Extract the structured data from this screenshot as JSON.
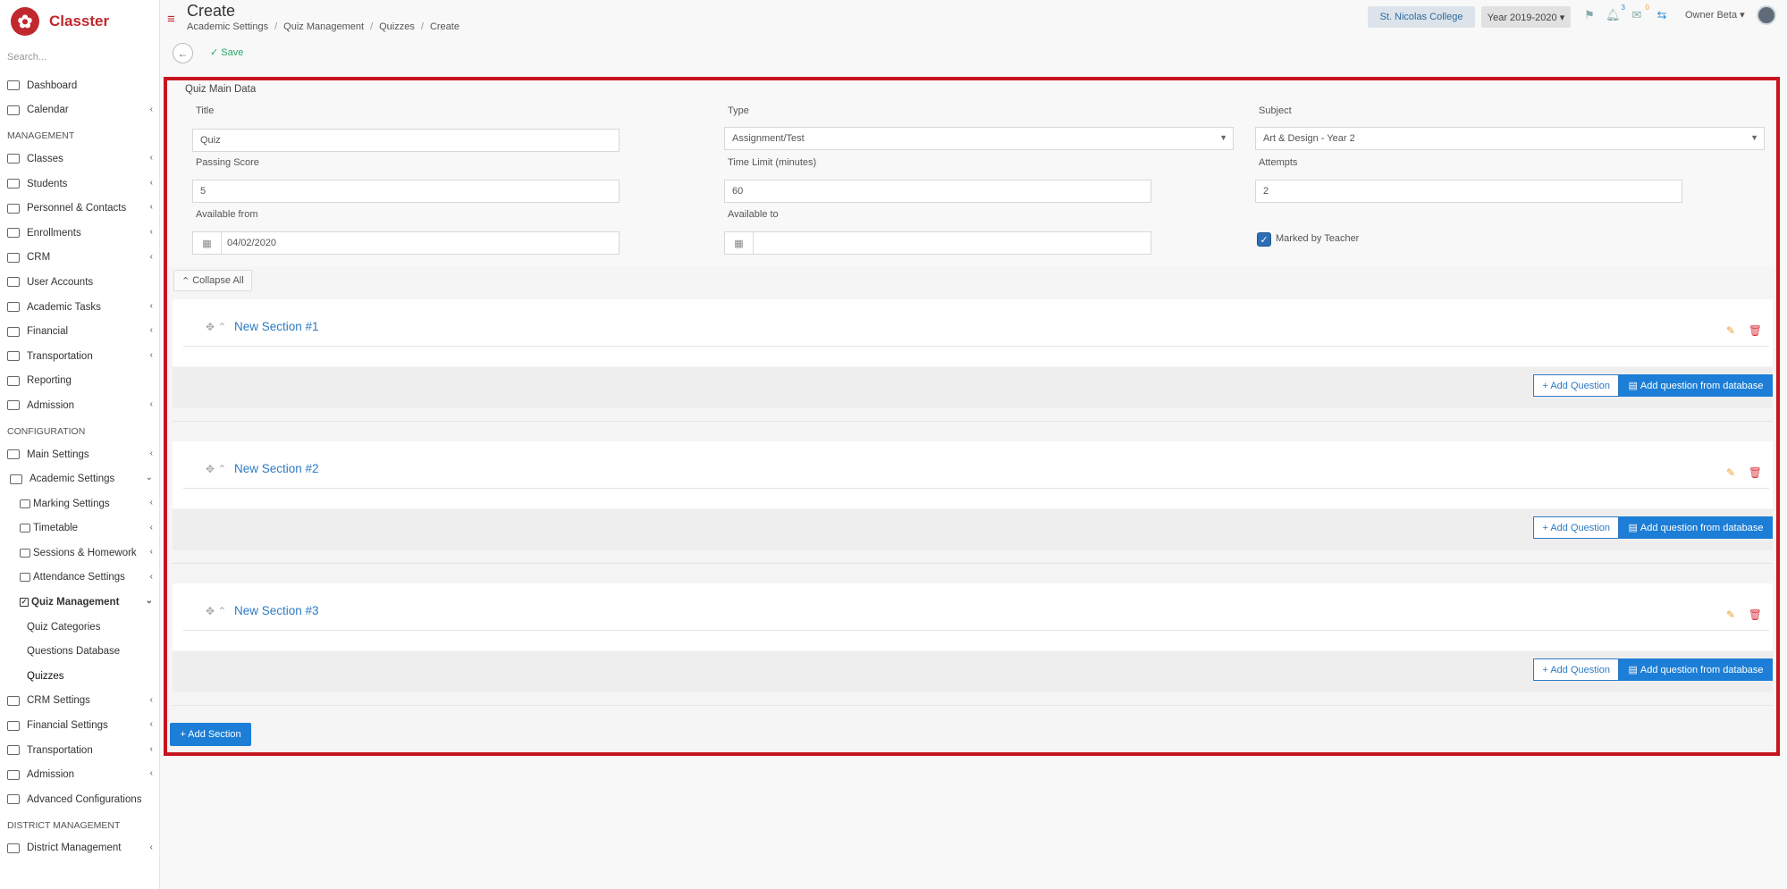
{
  "app": {
    "name": "Classter",
    "logo_glyph": "✿"
  },
  "sidebar": {
    "search_placeholder": "Search...",
    "items_top": [
      {
        "label": "Dashboard",
        "icon": "laptop-icon"
      },
      {
        "label": "Calendar",
        "icon": "calendar-icon"
      }
    ],
    "management_header": "MANAGEMENT",
    "management_items": [
      {
        "label": "Classes",
        "icon": "classes-icon"
      },
      {
        "label": "Students",
        "icon": "students-icon"
      },
      {
        "label": "Personnel & Contacts",
        "icon": "personnel-icon"
      },
      {
        "label": "Enrollments",
        "icon": "enrollments-icon"
      },
      {
        "label": "CRM",
        "icon": "crm-icon"
      },
      {
        "label": "User Accounts",
        "icon": "key-icon"
      },
      {
        "label": "Academic Tasks",
        "icon": "grid-icon"
      },
      {
        "label": "Financial",
        "icon": "money-icon"
      },
      {
        "label": "Transportation",
        "icon": "bus-icon"
      },
      {
        "label": "Reporting",
        "icon": "printer-icon"
      },
      {
        "label": "Admission",
        "icon": "bank-icon"
      }
    ],
    "configuration_header": "CONFIGURATION",
    "config_items": [
      {
        "label": "Main Settings",
        "icon": "sliders-icon"
      },
      {
        "label": "Academic Settings",
        "icon": "academic-icon"
      }
    ],
    "academic_sub": [
      {
        "label": "Marking Settings",
        "icon": "marking-icon"
      },
      {
        "label": "Timetable",
        "icon": "timetable-icon"
      },
      {
        "label": "Sessions & Homework",
        "icon": "sessions-icon"
      },
      {
        "label": "Attendance Settings",
        "icon": "attendance-icon"
      },
      {
        "label": "Quiz Management",
        "icon": "checkbox-icon"
      }
    ],
    "quiz_sub": [
      {
        "label": "Quiz Categories"
      },
      {
        "label": "Questions Database"
      },
      {
        "label": "Quizzes"
      }
    ],
    "config_items_after": [
      {
        "label": "CRM Settings",
        "icon": "crm-icon"
      },
      {
        "label": "Financial Settings",
        "icon": "money-icon"
      },
      {
        "label": "Transportation",
        "icon": "bus-icon"
      },
      {
        "label": "Admission",
        "icon": "bank-icon"
      },
      {
        "label": "Advanced Configurations",
        "icon": "gears-icon"
      }
    ],
    "district_header": "DISTRICT MANAGEMENT",
    "district_items": [
      {
        "label": "District Management",
        "icon": "list-icon"
      }
    ]
  },
  "topbar": {
    "title": "Create",
    "breadcrumb": [
      "Academic Settings",
      "Quiz Management",
      "Quizzes",
      "Create"
    ],
    "college": "St. Nicolas College",
    "year": "Year 2019-2020 ▾",
    "notif_count": "3",
    "mail_count": "0",
    "user": "Owner Beta ▾"
  },
  "actionbar": {
    "save_label": "✓ Save"
  },
  "form": {
    "section_title": "Quiz Main Data",
    "title_label": "Title",
    "title_value": "Quiz",
    "type_label": "Type",
    "type_value": "Assignment/Test",
    "subject_label": "Subject",
    "subject_value": "Art & Design - Year 2",
    "passing_label": "Passing Score",
    "passing_value": "5",
    "time_label": "Time Limit (minutes)",
    "time_value": "60",
    "attempts_label": "Attempts",
    "attempts_value": "2",
    "from_label": "Available from",
    "from_value": "04/02/2020",
    "to_label": "Available to",
    "to_value": "",
    "marked_label": "Marked by Teacher",
    "collapse_label": "Collapse All"
  },
  "sections": [
    {
      "name": "New Section #1"
    },
    {
      "name": "New Section #2"
    },
    {
      "name": "New Section #3"
    }
  ],
  "section_buttons": {
    "add_question": "+ Add Question",
    "add_from_db": "Add question from database"
  },
  "add_section_label": "+ Add Section",
  "colors": {
    "brand": "#c0282d",
    "primary": "#1c7ed6",
    "highlight_border": "#c8141e"
  }
}
